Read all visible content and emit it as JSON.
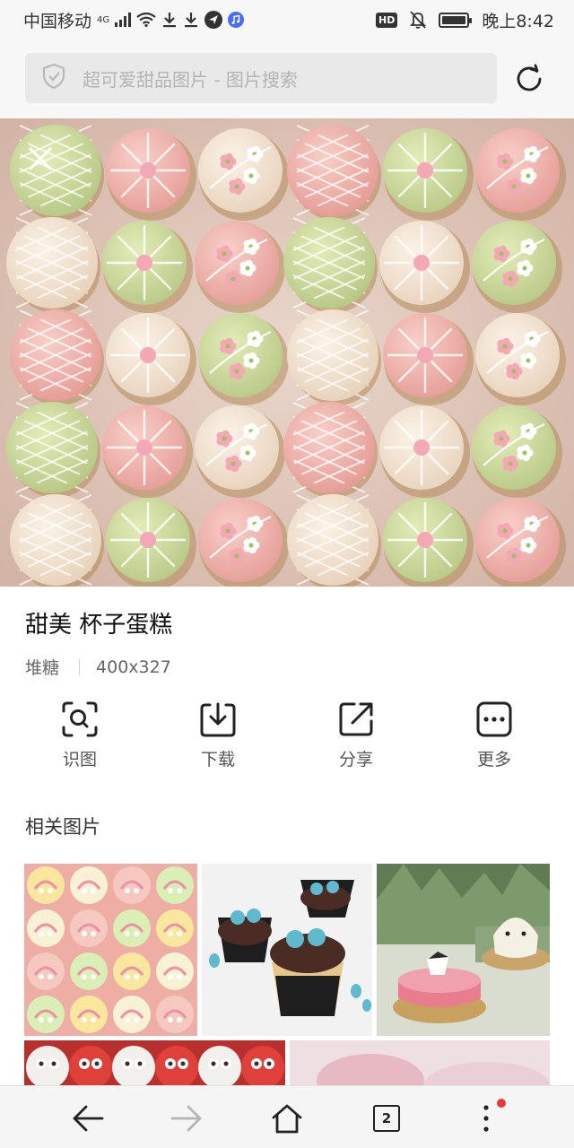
{
  "status_bar": {
    "carrier": "中国移动",
    "network": "4G",
    "hd": "HD",
    "time": "晚上8:42"
  },
  "search": {
    "text": "超可爱甜品图片 - 图片搜索",
    "icon": "shield-icon",
    "refresh_icon": "refresh-icon"
  },
  "image": {
    "title": "甜美 杯子蛋糕",
    "source": "堆糖",
    "dimensions": "400x327"
  },
  "actions": [
    {
      "label": "识图",
      "icon": "scan-search-icon"
    },
    {
      "label": "下载",
      "icon": "download-icon"
    },
    {
      "label": "分享",
      "icon": "share-icon"
    },
    {
      "label": "更多",
      "icon": "more-icon"
    }
  ],
  "related": {
    "title": "相关图片"
  },
  "bottom_nav": {
    "tab_count": "2",
    "items": [
      "back-icon",
      "forward-icon",
      "home-icon",
      "tabs-icon",
      "menu-icon"
    ]
  },
  "colors": {
    "cupcake_pink": "#f0b7b2",
    "cupcake_green": "#cddc9e",
    "cupcake_cream": "#f6e7d5",
    "notification_dot": "#e53935"
  }
}
